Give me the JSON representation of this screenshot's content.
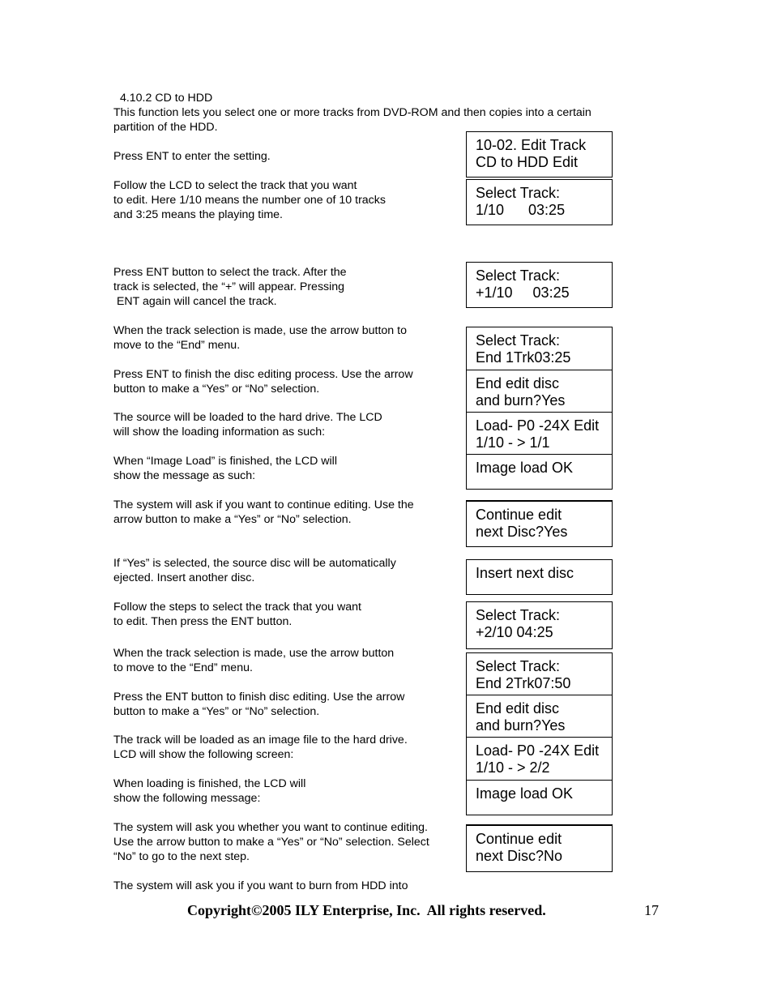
{
  "section": {
    "heading": " 4.10.2 CD to HDD",
    "intro": "This function lets you select one or more tracks from DVD-ROM and then copies into a certain\npartition of the HDD."
  },
  "instructions": [
    "Press ENT to enter the setting.",
    "Follow the LCD to select the track that you want\nto edit. Here 1/10 means the number one of 10 tracks\nand 3:25 means the playing time.",
    "Press ENT button to select the track. After the\ntrack is selected, the “+” will appear. Pressing\n ENT again will cancel the track.",
    "When the track selection is made, use the arrow button to\nmove to the “End” menu.",
    "Press ENT to finish the disc editing process. Use the arrow\nbutton to make a “Yes” or “No” selection.",
    "The source will be loaded to the hard drive. The LCD\nwill show the loading information as such:",
    "When “Image Load” is finished, the LCD will\nshow the message as such:",
    "The system will ask if you want to continue editing. Use the\narrow button to make a “Yes” or “No” selection.",
    "If “Yes” is selected, the source disc will be automatically\nejected. Insert another disc.",
    "Follow the steps to select the track that you want\nto edit. Then press the ENT button.",
    "When the track selection is made, use the arrow button\nto move to the “End” menu.",
    "Press the ENT button to finish disc editing. Use the arrow\nbutton to make a “Yes” or “No” selection.",
    "The track will be loaded as an image file to the hard drive.\nLCD will show the following screen:",
    "When loading is finished, the LCD will\nshow the following message:",
    "The system will ask you whether you want to continue editing.\nUse the arrow button to make a “Yes” or “No” selection. Select\n“No” to go to the next step.",
    "The system will ask you if you want to burn from HDD into"
  ],
  "lcd_screens": {
    "edit_track": [
      "10-02. Edit Track\nCD to HDD Edit",
      "Select Track:\n1/10      03:25"
    ],
    "selected": [
      "Select Track:\n+1/10     03:25"
    ],
    "group1": [
      "Select Track:\nEnd 1Trk03:25",
      "End edit disc\nand burn?Yes",
      "Load- P0 -24X Edit\n1/10 - > 1/1",
      "Image load OK"
    ],
    "continue_yes": [
      "Continue edit\nnext Disc?Yes"
    ],
    "insert_next": [
      "Insert next disc"
    ],
    "selected2": [
      "Select Track:\n+2/10 04:25"
    ],
    "group2": [
      "Select Track:\nEnd 2Trk07:50",
      "End edit disc\nand burn?Yes",
      "Load- P0 -24X Edit\n1/10 - > 2/2",
      "Image load OK"
    ],
    "continue_no": [
      "Continue edit\nnext Disc?No"
    ]
  },
  "footer": {
    "copyright": "Copyright©2005 ILY Enterprise, Inc.  All rights reserved.",
    "page_number": "17"
  }
}
